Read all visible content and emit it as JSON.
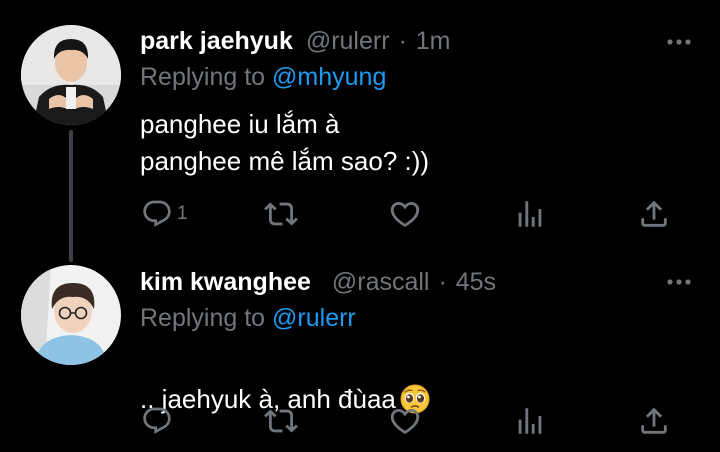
{
  "tweets": [
    {
      "name": "park jaehyuk",
      "handle": "@rulerr",
      "separator": "·",
      "time": "1m",
      "replying_prefix": "Replying to ",
      "replying_to": "@mhyung",
      "text": "panghee iu lắm à\npanghee mê lắm sao? :))",
      "reply_count": "1",
      "retweet_count": "",
      "like_count": ""
    },
    {
      "name": "kim kwanghee",
      "handle": "@rascall",
      "separator": "·",
      "time": "45s",
      "replying_prefix": "Replying to ",
      "replying_to": "@rulerr",
      "text": ".. jaehyuk à, anh đùaa",
      "emoji": "pleading-face-emoji",
      "reply_count": "",
      "retweet_count": "",
      "like_count": ""
    }
  ],
  "icons": [
    "reply-icon",
    "retweet-icon",
    "like-icon",
    "analytics-icon",
    "share-icon",
    "more-icon"
  ],
  "colors": {
    "background": "#000000",
    "text": "#e7e9ea",
    "secondary": "#71767b",
    "mention": "#1d9bf0",
    "thread_line": "#3d4145"
  }
}
